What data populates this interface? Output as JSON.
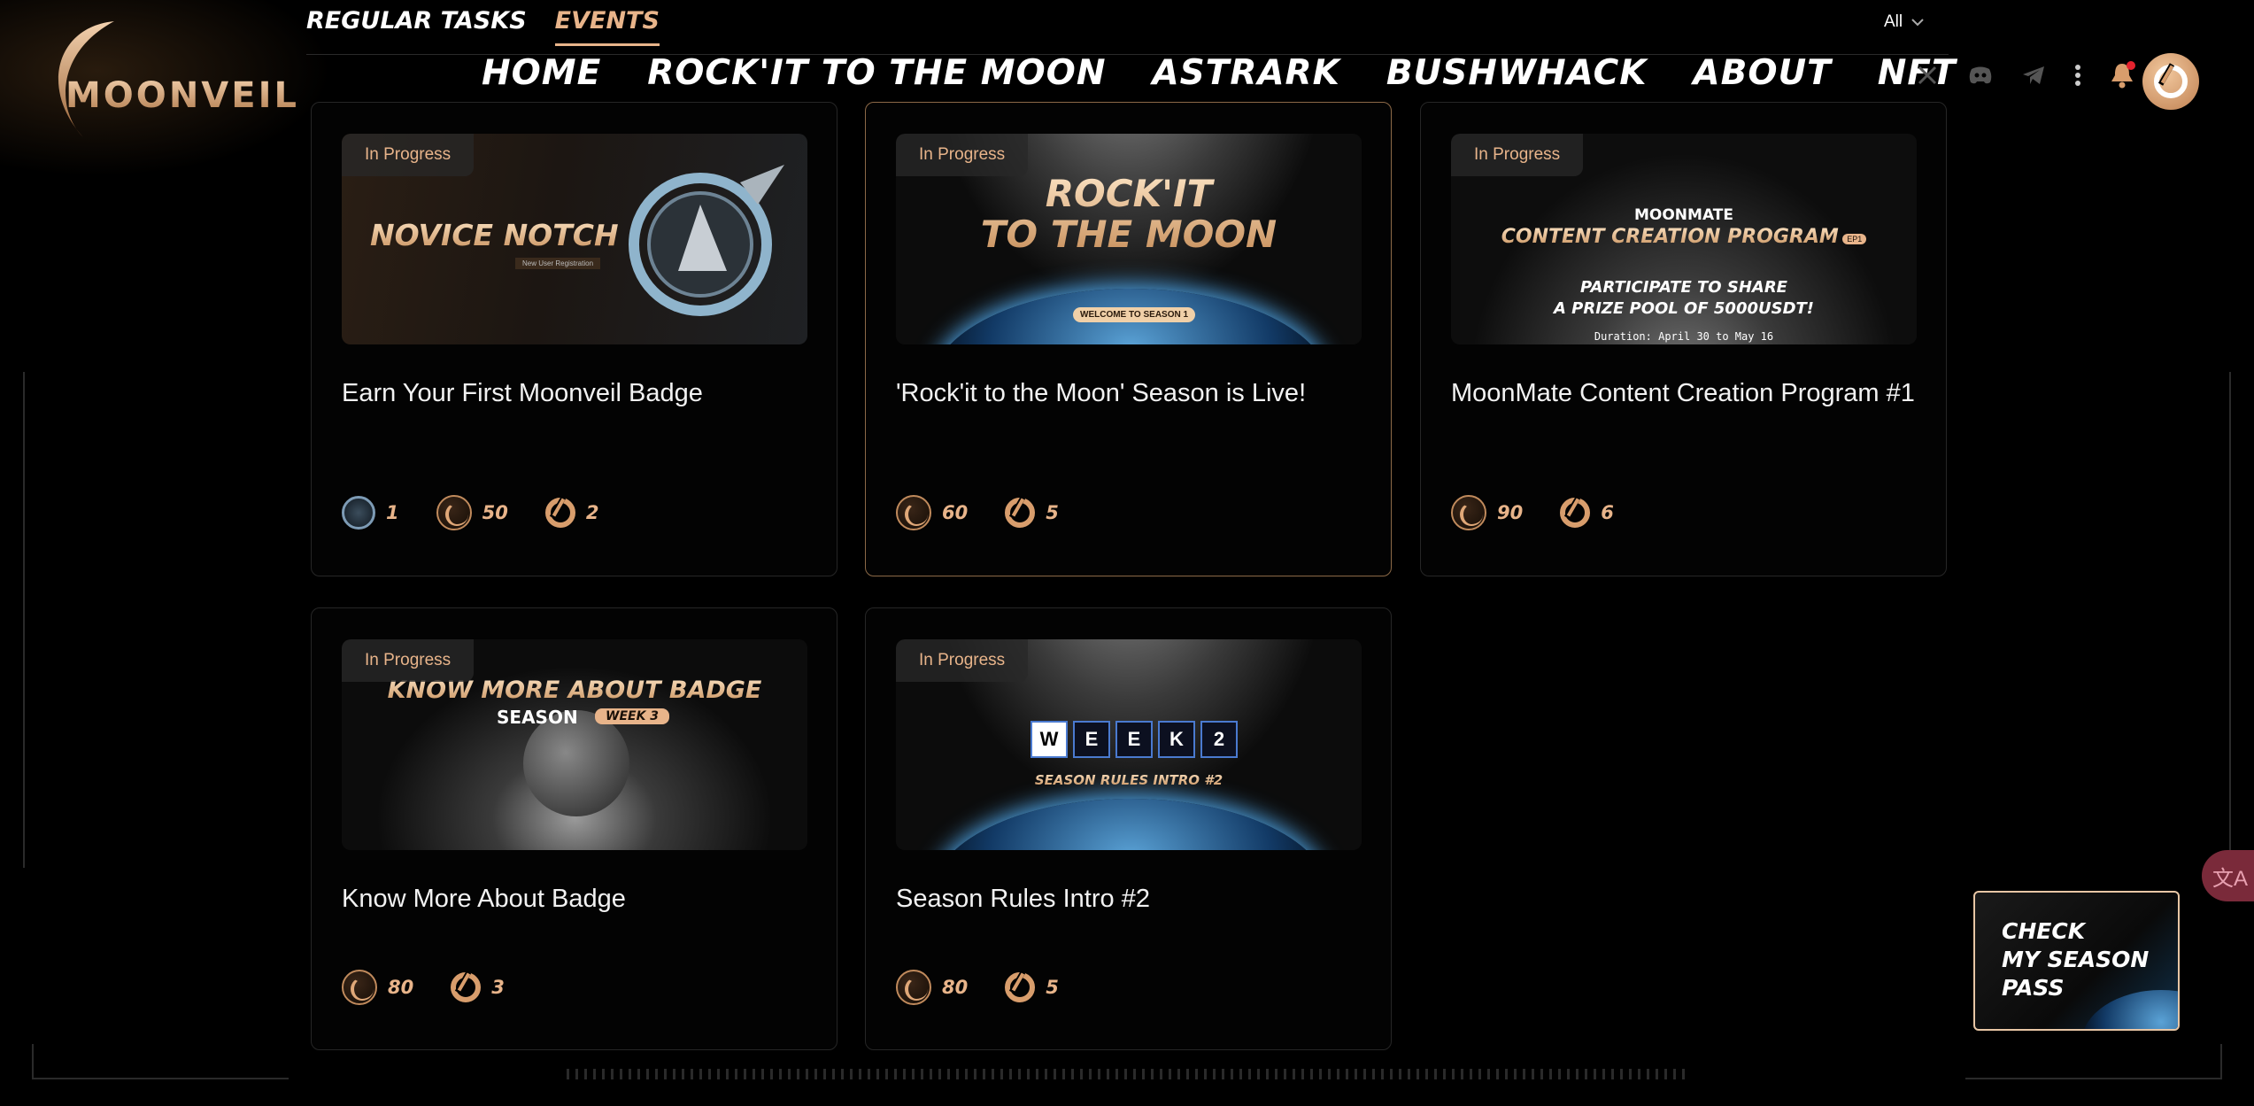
{
  "brand": {
    "name": "MOONVEIL"
  },
  "tabs": [
    {
      "label": "REGULAR TASKS",
      "active": false
    },
    {
      "label": "EVENTS",
      "active": true
    }
  ],
  "filter": {
    "value": "All"
  },
  "nav": [
    "HOME",
    "ROCK'IT TO THE MOON",
    "ASTRARK",
    "BUSHWHACK",
    "ABOUT",
    "NFT"
  ],
  "header_icons": [
    "x-icon",
    "discord-icon",
    "telegram-icon",
    "more-vertical-icon",
    "bell-icon"
  ],
  "cards": [
    {
      "status": "In Progress",
      "title": "Earn Your First Moonveil Badge",
      "banner_text": [
        "NOVICE NOTCH",
        "New User Registration"
      ],
      "rewards": [
        {
          "type": "badge",
          "value": "1"
        },
        {
          "type": "moon-coin",
          "value": "50"
        },
        {
          "type": "ring-point",
          "value": "2"
        }
      ]
    },
    {
      "status": "In Progress",
      "title": "'Rock'it to the Moon' Season is Live!",
      "banner_text": [
        "ROCK'IT",
        "TO THE MOON",
        "WELCOME TO SEASON 1"
      ],
      "rewards": [
        {
          "type": "moon-coin",
          "value": "60"
        },
        {
          "type": "ring-point",
          "value": "5"
        }
      ]
    },
    {
      "status": "In Progress",
      "title": "MoonMate Content Creation Program #1",
      "banner_text": [
        "MOONMATE",
        "CONTENT CREATION PROGRAM",
        "EP1",
        "PARTICIPATE TO SHARE",
        "A PRIZE POOL OF 5000USDT!",
        "Duration: April 30 to May 16"
      ],
      "rewards": [
        {
          "type": "moon-coin",
          "value": "90"
        },
        {
          "type": "ring-point",
          "value": "6"
        }
      ]
    },
    {
      "status": "In Progress",
      "title": "Know More About Badge",
      "banner_text": [
        "KNOW MORE ABOUT BADGE",
        "SEASON",
        "WEEK 3"
      ],
      "rewards": [
        {
          "type": "moon-coin",
          "value": "80"
        },
        {
          "type": "ring-point",
          "value": "3"
        }
      ]
    },
    {
      "status": "In Progress",
      "title": "Season Rules Intro #2",
      "banner_text": [
        "W",
        "E",
        "E",
        "K",
        "2",
        "SEASON RULES INTRO #2"
      ],
      "rewards": [
        {
          "type": "moon-coin",
          "value": "80"
        },
        {
          "type": "ring-point",
          "value": "5"
        }
      ]
    }
  ],
  "season_pass": {
    "label": "CHECK\nMY SEASON\nPASS"
  },
  "colors": {
    "accent": "#e8b48a",
    "card_border": "#262626",
    "highlight_border": "#8c6947"
  }
}
